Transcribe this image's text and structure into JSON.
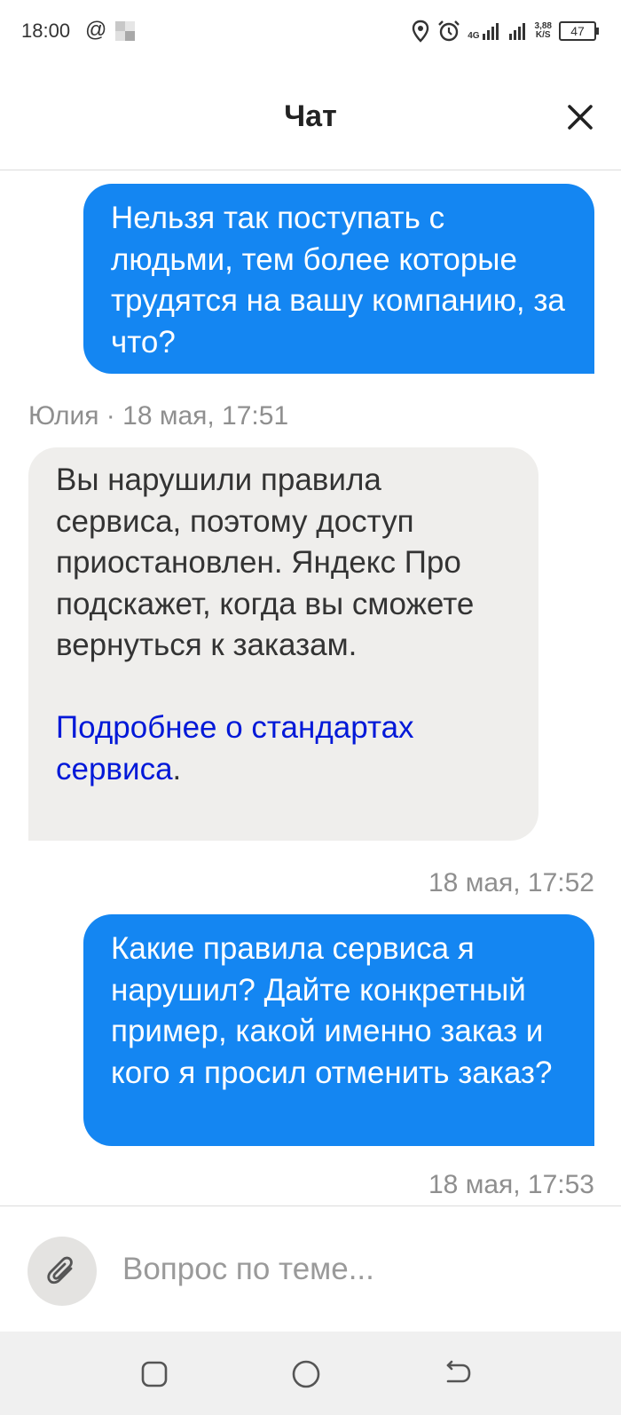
{
  "status_bar": {
    "time": "18:00",
    "at_symbol": "@",
    "network_label": "4G",
    "speed_value": "3,88",
    "speed_unit": "K/S",
    "battery": "47",
    "icons": [
      "location-icon",
      "alarm-icon",
      "signal-4g-icon",
      "signal-icon",
      "battery-icon"
    ]
  },
  "header": {
    "title": "Чат"
  },
  "messages": [
    {
      "direction": "outgoing",
      "text": "Нельзя так поступать с людьми, тем более которые трудятся на вашу компанию, за что?"
    },
    {
      "direction": "incoming",
      "meta": "Юлия · 18 мая, 17:51",
      "text": "Вы нарушили правила сервиса, поэтому доступ приостановлен. Яндекс Про подскажет, когда вы сможете вернуться к заказам.",
      "link_text": "Подробнее о стандартах сервиса",
      "link_suffix": "."
    },
    {
      "direction": "outgoing",
      "meta": "18 мая, 17:52",
      "text": "Какие правила сервиса я нарушил? Дайте конкретный пример, какой именно заказ и кого я просил отменить заказ?"
    },
    {
      "direction": "outgoing",
      "meta": "18 мая, 17:53"
    }
  ],
  "composer": {
    "placeholder": "Вопрос по теме..."
  },
  "colors": {
    "outgoing_bubble": "#1486f2",
    "incoming_bubble": "#efeeec",
    "link": "#0018d8",
    "meta_text": "#8f8f8f"
  }
}
